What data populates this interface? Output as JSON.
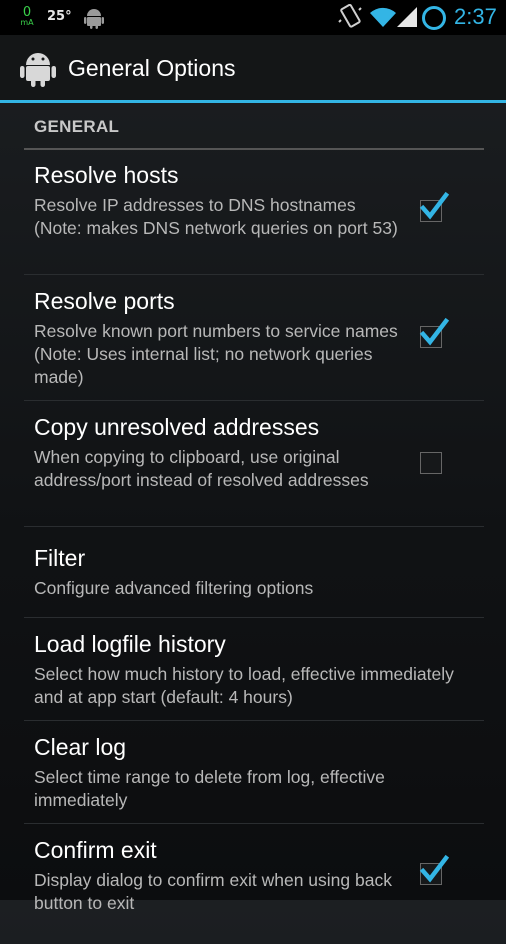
{
  "status_bar": {
    "ma_value": "0",
    "ma_unit": "mA",
    "temperature": "25°",
    "time": "2:37"
  },
  "action_bar": {
    "title": "General Options"
  },
  "section": {
    "header": "GENERAL"
  },
  "prefs": [
    {
      "title": "Resolve hosts",
      "summary": "Resolve IP addresses to DNS hostnames (Note: makes DNS network queries on port 53)",
      "checked": true
    },
    {
      "title": "Resolve ports",
      "summary": "Resolve known port numbers to service names (Note: Uses internal list; no network queries made)",
      "checked": true
    },
    {
      "title": "Copy unresolved addresses",
      "summary": "When copying to clipboard, use original address/port instead of resolved addresses",
      "checked": false
    },
    {
      "title": "Filter",
      "summary": "Configure advanced filtering options"
    },
    {
      "title": "Load logfile history",
      "summary": "Select how much history to load, effective immediately and at app start (default: 4 hours)"
    },
    {
      "title": "Clear log",
      "summary": "Select time range to delete from log, effective immediately"
    },
    {
      "title": "Confirm exit",
      "summary": "Display dialog to confirm exit when using back button to exit",
      "checked": true
    }
  ],
  "colors": {
    "accent": "#33b5e5",
    "battery_text": "#3ad14b"
  },
  "icons": [
    "android-icon",
    "vibrate-icon",
    "wifi-icon",
    "signal-icon",
    "circle-icon",
    "checkmark-icon"
  ]
}
